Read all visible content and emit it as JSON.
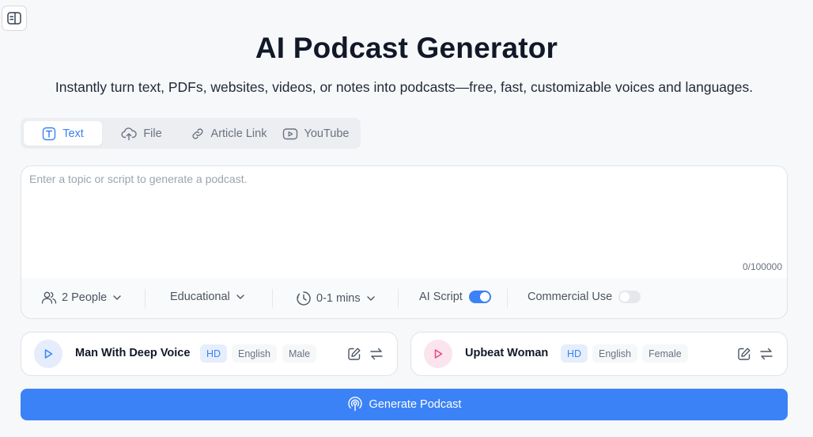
{
  "header": {
    "title": "AI Podcast Generator",
    "subtitle": "Instantly turn text, PDFs, websites, videos, or notes into podcasts—free, fast, customizable voices and languages."
  },
  "tabs": [
    {
      "label": "Text",
      "icon": "text-icon",
      "active": true
    },
    {
      "label": "File",
      "icon": "cloud-upload-icon",
      "active": false
    },
    {
      "label": "Article Link",
      "icon": "link-icon",
      "active": false
    },
    {
      "label": "YouTube",
      "icon": "youtube-icon",
      "active": false
    }
  ],
  "composer": {
    "placeholder": "Enter a topic or script to generate a podcast.",
    "value": "",
    "char_count": "0/100000"
  },
  "options": {
    "people": "2 People",
    "style": "Educational",
    "duration": "0-1 mins",
    "ai_script_label": "AI Script",
    "ai_script_on": true,
    "commercial_label": "Commercial Use",
    "commercial_on": false
  },
  "voices": [
    {
      "name": "Man With Deep Voice",
      "quality": "HD",
      "language": "English",
      "gender": "Male"
    },
    {
      "name": "Upbeat Woman",
      "quality": "HD",
      "language": "English",
      "gender": "Female"
    }
  ],
  "generate": {
    "label": "Generate Podcast"
  },
  "colors": {
    "accent": "#3b82f6",
    "host1_play_bg": "#e5ecfb",
    "host2_play_bg": "#fbe4ee",
    "host2_play_icon": "#e64980"
  }
}
